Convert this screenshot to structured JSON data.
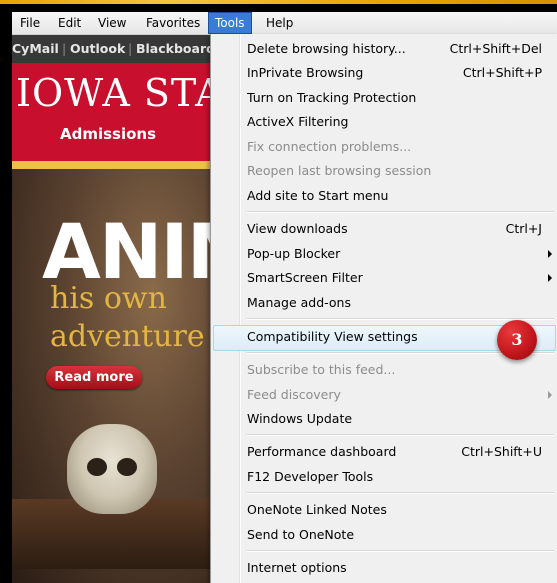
{
  "menubar": {
    "items": [
      {
        "label": "File"
      },
      {
        "label": "Edit"
      },
      {
        "label": "View"
      },
      {
        "label": "Favorites"
      },
      {
        "label": "Tools"
      },
      {
        "label": "Help"
      }
    ]
  },
  "page": {
    "links": [
      "CyMail",
      "Outlook",
      "Blackboard"
    ],
    "banner_title": "IOWA STATE",
    "admissions": "Admissions",
    "hero_big": "ANIM",
    "hero_line1": "his own",
    "hero_line2": "adventure",
    "read_more": "Read more"
  },
  "menu": {
    "items": [
      {
        "label": "Delete browsing history...",
        "shortcut": "Ctrl+Shift+Del"
      },
      {
        "label": "InPrivate Browsing",
        "shortcut": "Ctrl+Shift+P"
      },
      {
        "label": "Turn on Tracking Protection",
        "shortcut": ""
      },
      {
        "label": "ActiveX Filtering",
        "shortcut": ""
      },
      {
        "label": "Fix connection problems...",
        "shortcut": ""
      },
      {
        "label": "Reopen last browsing session",
        "shortcut": ""
      },
      {
        "label": "Add site to Start menu",
        "shortcut": ""
      },
      {
        "label": "View downloads",
        "shortcut": "Ctrl+J"
      },
      {
        "label": "Pop-up Blocker",
        "shortcut": ""
      },
      {
        "label": "SmartScreen Filter",
        "shortcut": ""
      },
      {
        "label": "Manage add-ons",
        "shortcut": ""
      },
      {
        "label": "Compatibility View settings",
        "shortcut": ""
      },
      {
        "label": "Subscribe to this feed...",
        "shortcut": ""
      },
      {
        "label": "Feed discovery",
        "shortcut": ""
      },
      {
        "label": "Windows Update",
        "shortcut": ""
      },
      {
        "label": "Performance dashboard",
        "shortcut": "Ctrl+Shift+U"
      },
      {
        "label": "F12 Developer Tools",
        "shortcut": ""
      },
      {
        "label": "OneNote Linked Notes",
        "shortcut": ""
      },
      {
        "label": "Send to OneNote",
        "shortcut": ""
      },
      {
        "label": "Internet options",
        "shortcut": ""
      }
    ]
  },
  "callout": {
    "number": "3"
  },
  "colors": {
    "accent": "#3a7bd5",
    "banner_red": "#c8102e",
    "gold": "#f1be48",
    "badge_red": "#c0151b"
  }
}
